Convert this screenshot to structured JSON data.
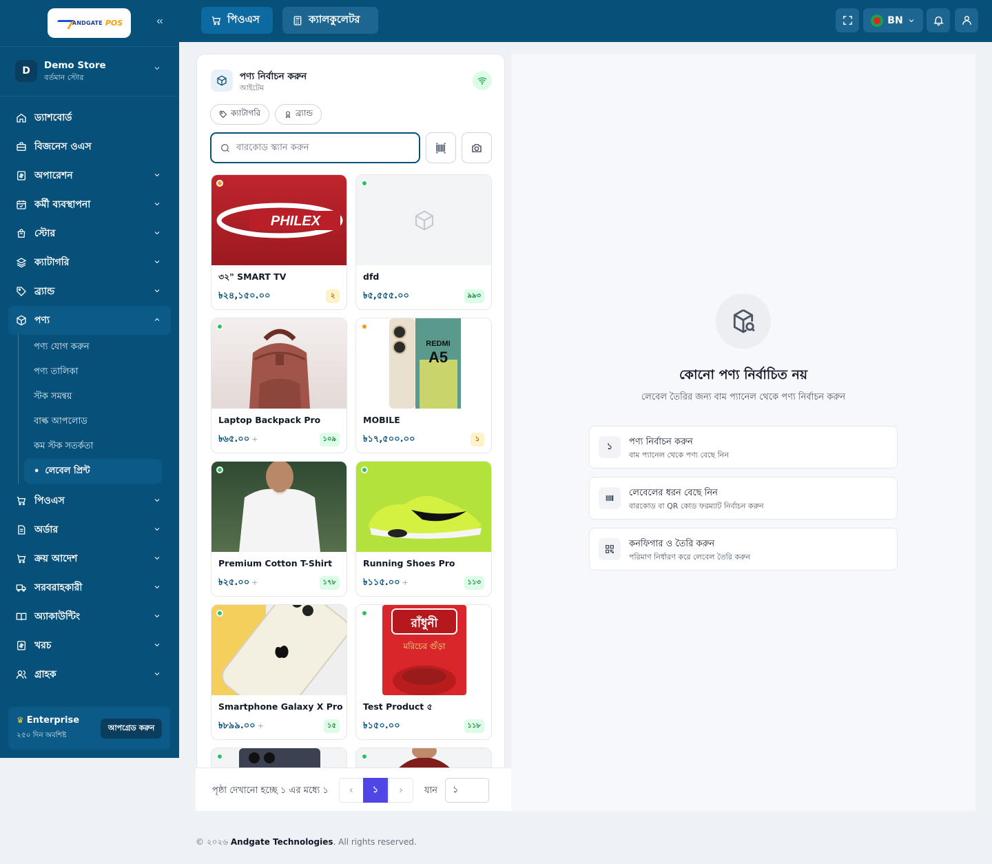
{
  "sidebar": {
    "logo_text": "ANDGATE",
    "logo_pos": "POS",
    "store": {
      "avatar": "D",
      "name": "Demo Store",
      "subtitle": "বর্তমান স্টোর"
    },
    "items": [
      {
        "label": "ড্যাশবোর্ড",
        "icon": "home-icon"
      },
      {
        "label": "বিজনেস ওএস",
        "icon": "briefcase-icon"
      },
      {
        "label": "অপারেশন",
        "icon": "receipt-icon"
      },
      {
        "label": "কর্মী ব্যবস্থাপনা",
        "icon": "calendar-icon"
      },
      {
        "label": "স্টোর",
        "icon": "store-icon"
      },
      {
        "label": "ক্যাটাগরি",
        "icon": "layers-icon"
      },
      {
        "label": "ব্র্যান্ড",
        "icon": "tag-icon"
      },
      {
        "label": "পণ্য",
        "icon": "box-icon"
      },
      {
        "label": "পিওএস",
        "icon": "cart-icon"
      },
      {
        "label": "অর্ডার",
        "icon": "document-icon"
      },
      {
        "label": "ক্রয় আদেশ",
        "icon": "cart-icon"
      },
      {
        "label": "সরবরাহকারী",
        "icon": "truck-icon"
      },
      {
        "label": "অ্যাকাউন্টিং",
        "icon": "book-icon"
      },
      {
        "label": "খরচ",
        "icon": "receipt-icon"
      },
      {
        "label": "গ্রাহক",
        "icon": "users-icon"
      }
    ],
    "product_sub": [
      "পণ্য যোগ করুন",
      "পণ্য তালিকা",
      "স্টক সমন্বয়",
      "বাল্ক আপলোড",
      "কম স্টক সতর্কতা",
      "লেবেল প্রিন্ট"
    ],
    "plan": {
      "name": "Enterprise",
      "days": "২৫০ দিন অবশিষ্ট",
      "upgrade": "আপগ্রেড করুন"
    }
  },
  "topbar": {
    "tabs": [
      "পিওএস",
      "ক্যালকুলেটর"
    ],
    "lang": "BN"
  },
  "product_panel": {
    "title": "পণ্য নির্বাচন করুন",
    "subtitle": "আইটেম",
    "chips": [
      "ক্যাটাগরি",
      "ব্র্যান্ড"
    ],
    "search_placeholder": "বারকোড স্ক্যান করুন",
    "products": [
      {
        "name": "৩২\" SMART TV",
        "price": "৳২৪,১৫০.০০",
        "plus": "",
        "stock": "২",
        "status": "low",
        "image": "philex-tv"
      },
      {
        "name": "dfd",
        "price": "৳৫,৫৫৫.০০",
        "plus": "",
        "stock": "৯৯৩",
        "status": "ok",
        "image": "placeholder"
      },
      {
        "name": "Laptop Backpack Pro",
        "price": "৳৬৫.০০",
        "plus": "+",
        "stock": "১০৯",
        "status": "ok",
        "image": "backpack"
      },
      {
        "name": "MOBILE",
        "price": "৳১৭,৫০০.০০",
        "plus": "",
        "stock": "১",
        "status": "low",
        "image": "redmi-phone"
      },
      {
        "name": "Premium Cotton T-Shirt",
        "price": "৳২৫.০০",
        "plus": "+",
        "stock": "১৭৮",
        "status": "ok",
        "image": "tshirt"
      },
      {
        "name": "Running Shoes Pro",
        "price": "৳১১৫.০০",
        "plus": "+",
        "stock": "১১৩",
        "status": "ok",
        "image": "shoe"
      },
      {
        "name": "Smartphone Galaxy X Pro",
        "price": "৳৮৯৯.০০",
        "plus": "+",
        "stock": "১৫",
        "status": "ok",
        "image": "iphone"
      },
      {
        "name": "Test Product ৫",
        "price": "৳১৫০.০০",
        "plus": "",
        "stock": "১১৮",
        "status": "ok",
        "image": "spice-pack"
      },
      {
        "name": "",
        "price": "",
        "plus": "",
        "stock": "",
        "status": "ok",
        "image": "camera-phone"
      },
      {
        "name": "",
        "price": "",
        "plus": "",
        "stock": "",
        "status": "ok",
        "image": "red-shirt"
      }
    ],
    "spice_brand": "রাঁধুনী",
    "spice_label": "মরিচের গুঁড়া",
    "tv_brand": "PHILEX",
    "phone_brand": "REDMI",
    "phone_model": "A5"
  },
  "pagination": {
    "text": "পৃষ্ঠা দেখানো হচ্ছে ১ এর মধ্যে ১",
    "current": "১",
    "go_label": "যান",
    "go_value": "১"
  },
  "empty_state": {
    "title": "কোনো পণ্য নির্বাচিত নয়",
    "subtitle": "লেবেল তৈরির জন্য বাম প্যানেল থেকে পণ্য নির্বাচন করুন",
    "steps": [
      {
        "badge": "১",
        "title": "পণ্য নির্বাচন করুন",
        "desc": "বাম প্যানেল থেকে পণ্য বেছে নিন"
      },
      {
        "badge": "",
        "title": "লেবেলের ধরন বেছে নিন",
        "desc": "বারকোড বা QR কোড ফরম্যাট নির্বাচন করুন"
      },
      {
        "badge": "",
        "title": "কনফিগার ও তৈরি করুন",
        "desc": "পরিমাণ নির্ধারণ করে লেবেল তৈরি করুন"
      }
    ]
  },
  "footer": {
    "prefix": "© ২০২৬",
    "company": "Andgate Technologies",
    "suffix": ". All rights reserved."
  },
  "colors": {
    "sidebar": "#06507a",
    "accent": "#4f46e5",
    "stock_ok": "#22c55e",
    "stock_low": "#f59e0b"
  }
}
